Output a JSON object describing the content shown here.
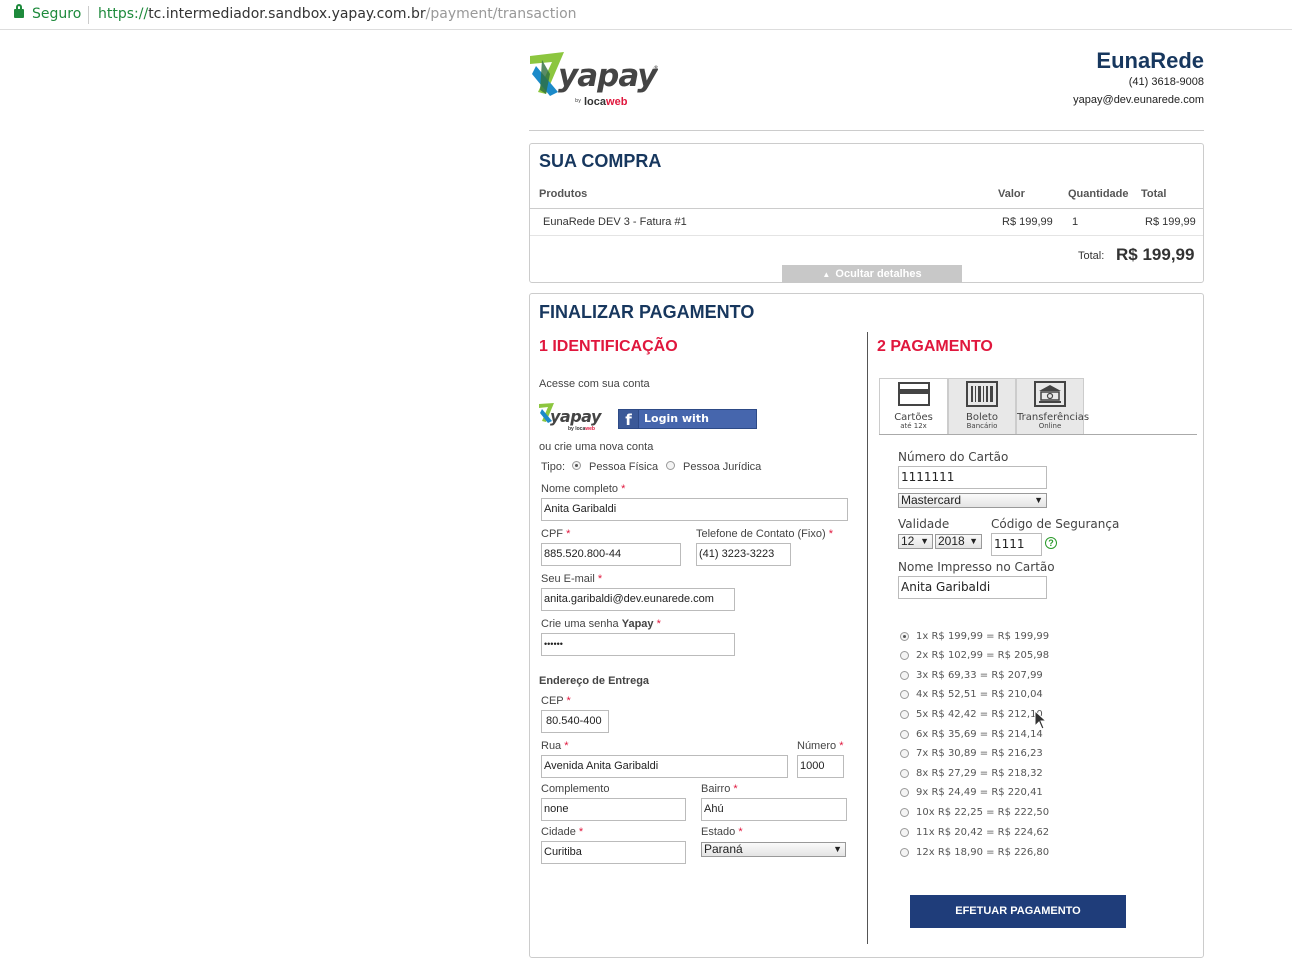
{
  "browser": {
    "secure_label": "Seguro",
    "url_scheme": "https://",
    "url_host": "tc.intermediador.sandbox.yapay.com.br",
    "url_path": "/payment/transaction"
  },
  "brand": {
    "logo_text": "yapay",
    "logo_sub": "by locaweb",
    "accent": "#e0173d",
    "navy": "#17375e"
  },
  "merchant": {
    "name": "EunaRede",
    "phone": "(41) 3618-9008",
    "email": "yapay@dev.eunarede.com"
  },
  "compra": {
    "title": "SUA COMPRA",
    "headers": {
      "produtos": "Produtos",
      "valor": "Valor",
      "quantidade": "Quantidade",
      "total": "Total"
    },
    "items": [
      {
        "produto": "EunaRede DEV 3 - Fatura #1",
        "valor": "R$ 199,99",
        "quantidade": "1",
        "total": "R$ 199,99"
      }
    ],
    "total_label": "Total:",
    "total_value": "R$ 199,99",
    "hide_details": "Ocultar detalhes"
  },
  "finalizar": {
    "title": "FINALIZAR PAGAMENTO",
    "identificacao": {
      "title": "1 IDENTIFICAÇÃO",
      "access_text": "Acesse com sua conta",
      "fb_login": "Login with Facebook",
      "create_text": "ou crie uma nova conta",
      "tipo_label": "Tipo:",
      "tipo_pf": "Pessoa Física",
      "tipo_pj": "Pessoa Jurídica",
      "nome_label": "Nome completo",
      "nome_value": "Anita Garibaldi",
      "cpf_label": "CPF",
      "cpf_value": "885.520.800-44",
      "telefone_label": "Telefone de Contato (Fixo)",
      "telefone_value": "(41) 3223-3223",
      "email_label": "Seu E-mail",
      "email_value": "anita.garibaldi@dev.eunarede.com",
      "senha_label": "Crie uma senha",
      "senha_brand": "Yapay",
      "senha_value": "••••••",
      "endereco_title": "Endereço de Entrega",
      "cep_label": "CEP",
      "cep_value": "80.540-400",
      "rua_label": "Rua",
      "rua_value": "Avenida Anita Garibaldi",
      "numero_label": "Número",
      "numero_value": "1000",
      "complemento_label": "Complemento",
      "complemento_value": "none",
      "bairro_label": "Bairro",
      "bairro_value": "Ahú",
      "cidade_label": "Cidade",
      "cidade_value": "Curitiba",
      "estado_label": "Estado",
      "estado_value": "Paraná"
    },
    "pagamento": {
      "title": "2 PAGAMENTO",
      "tabs": [
        {
          "label": "Cartões",
          "sub": "até 12x",
          "icon": "credit-card-icon"
        },
        {
          "label": "Boleto",
          "sub": "Bancário",
          "icon": "barcode-icon"
        },
        {
          "label": "Transferências",
          "sub": "Online",
          "icon": "bank-icon"
        }
      ],
      "card_number_label": "Número do Cartão",
      "card_number_value": "1111111",
      "brand_value": "Mastercard",
      "validade_label": "Validade",
      "month_value": "12",
      "year_value": "2018",
      "cvv_label": "Código de Segurança",
      "cvv_value": "1111",
      "name_label": "Nome Impresso no Cartão",
      "name_value": "Anita Garibaldi",
      "installments": [
        "1x R$ 199,99 = R$ 199,99",
        "2x R$ 102,99 = R$ 205,98",
        "3x R$ 69,33 = R$ 207,99",
        "4x R$ 52,51 = R$ 210,04",
        "5x R$ 42,42 = R$ 212,10",
        "6x R$ 35,69 = R$ 214,14",
        "7x R$ 30,89 = R$ 216,23",
        "8x R$ 27,29 = R$ 218,32",
        "9x R$ 24,49 = R$ 220,41",
        "10x R$ 22,25 = R$ 222,50",
        "11x R$ 20,42 = R$ 224,62",
        "12x R$ 18,90 = R$ 226,80"
      ],
      "selected_installment": 0,
      "submit_label": "EFETUAR PAGAMENTO"
    }
  }
}
